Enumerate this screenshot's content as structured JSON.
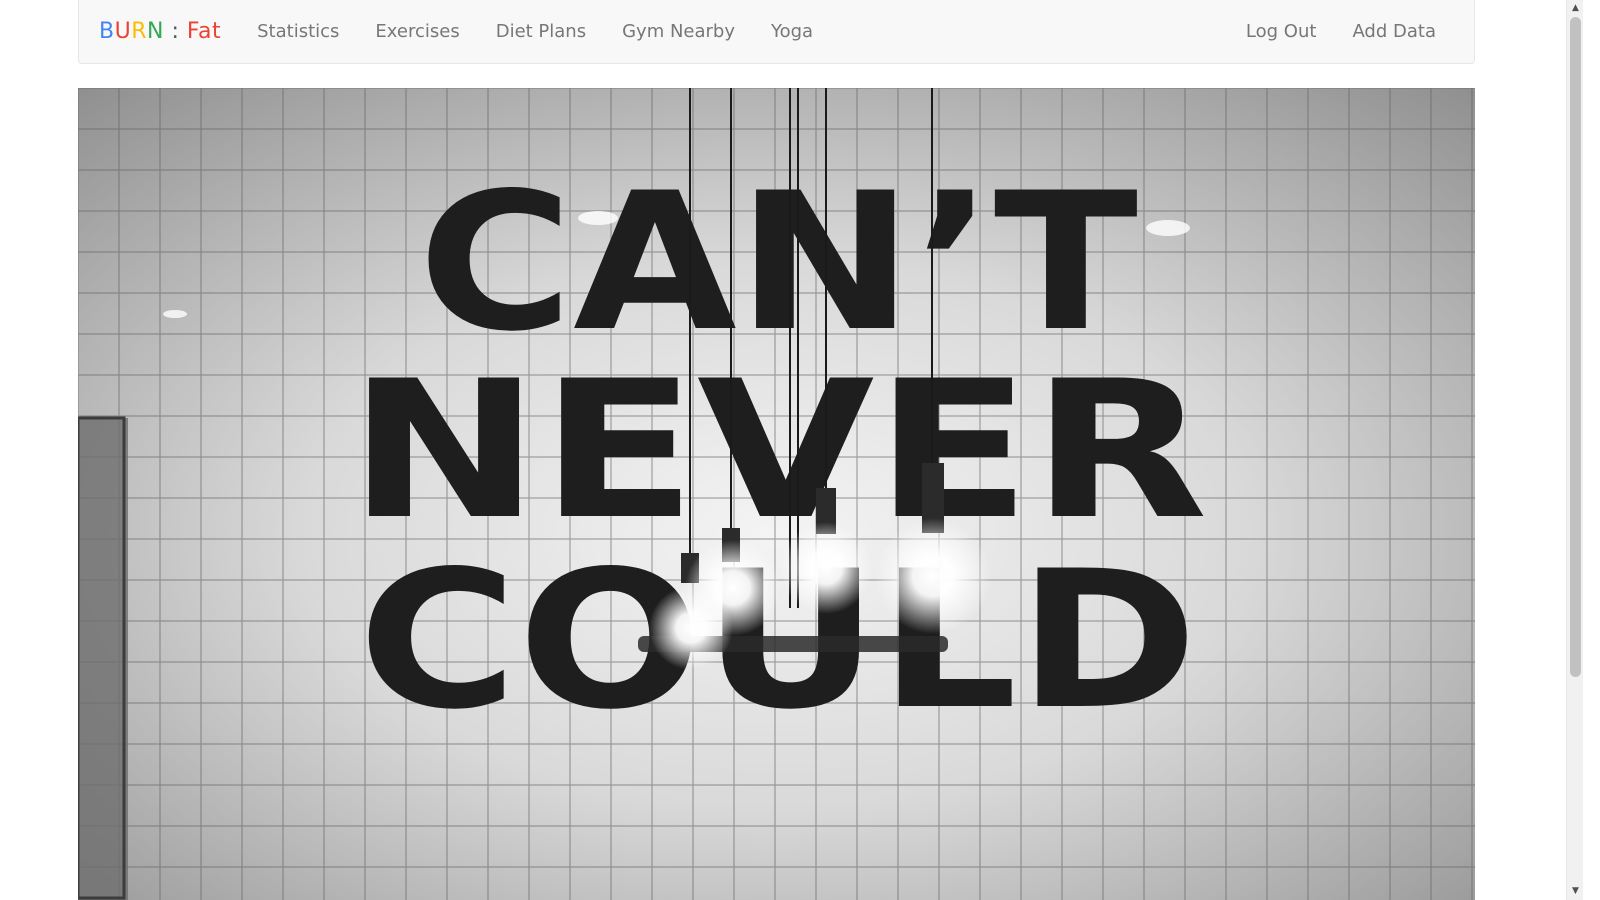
{
  "brand": {
    "letters": [
      {
        "char": "B",
        "color": "#4285F4"
      },
      {
        "char": "U",
        "color": "#EA4335"
      },
      {
        "char": "R",
        "color": "#FBBC05"
      },
      {
        "char": "N",
        "color": "#34A853"
      },
      {
        "char": " : ",
        "color": "#555555"
      },
      {
        "char": "Fat",
        "color": "#EA4335"
      }
    ]
  },
  "nav": {
    "left": [
      "Statistics",
      "Exercises",
      "Diet Plans",
      "Gym Nearby",
      "Yoga"
    ],
    "right": [
      "Log Out",
      "Add Data"
    ]
  },
  "hero": {
    "lines": [
      "CAN’T",
      "NEVER",
      "COULD"
    ],
    "text_color": "#1e1e1e"
  },
  "scrollbar": {
    "up_glyph": "▲",
    "down_glyph": "▼"
  }
}
